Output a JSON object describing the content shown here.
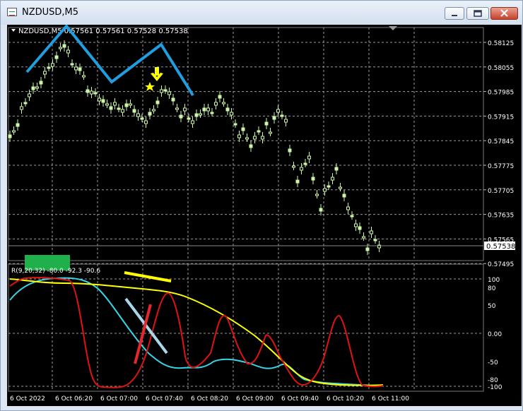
{
  "window": {
    "title": "NZDUSD,M5",
    "minimize_glyph": "minimize-icon",
    "maximize_glyph": "restore-icon",
    "close_glyph": "close-icon"
  },
  "chart": {
    "header": "NZDUSD,M5  0.57561 0.57561 0.57528 0.57538",
    "current_price": "0.57538",
    "price_ticks": [
      "0.58125",
      "0.58055",
      "0.57985",
      "0.57915",
      "0.57845",
      "0.57775",
      "0.57705",
      "0.57635",
      "0.57565",
      "0.57495"
    ],
    "time_labels": [
      "6 Oct 2022",
      "6 Oct 06:20",
      "6 Oct 07:00",
      "6 Oct 07:40",
      "6 Oct 08:20",
      "6 Oct 09:00",
      "6 Oct 09:40",
      "6 Oct 10:20",
      "6 Oct 11:00"
    ],
    "indicator_header": "R(9,20,32) -80.0 -92.3 -90.6",
    "indicator_ticks": [
      "100",
      "80",
      "50",
      "0.00",
      "-50",
      "-80",
      "-100"
    ],
    "colors": {
      "background": "#000000",
      "candle": "#ccf5a8",
      "grid": "#8a8a8a",
      "pattern": "#1f9fe0",
      "annotation": "#ffff00",
      "line_fast": "#e01212",
      "line_mid": "#ffff00",
      "line_slow": "#36d6e8",
      "marker_green": "#1fb04b",
      "divergence_red": "#e6262e",
      "divergence_blue": "#a9d6ea"
    }
  }
}
